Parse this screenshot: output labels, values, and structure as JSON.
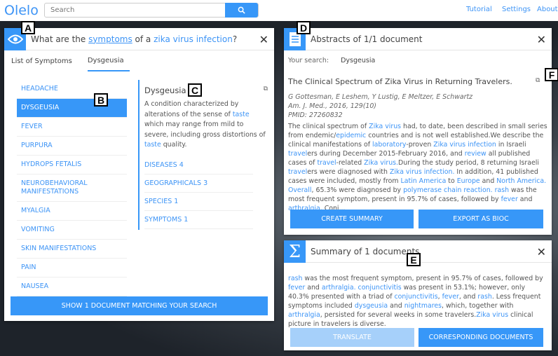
{
  "app": {
    "logo": "Olelo",
    "search_placeholder": "Search",
    "nav": [
      "Tutorial",
      "Settings",
      "About"
    ]
  },
  "colors": {
    "accent": "#3797f8",
    "link": "#3d94f6"
  },
  "question_panel": {
    "title": [
      {
        "t": "What are the "
      },
      {
        "t": "symptoms",
        "link": true,
        "underline": true
      },
      {
        "t": " of a "
      },
      {
        "t": "zika virus infection",
        "link": true
      },
      {
        "t": "?"
      }
    ],
    "icon": "eye-icon",
    "tabs": [
      {
        "label": "List of Symptoms",
        "active": false
      },
      {
        "label": "Dysgeusia",
        "active": true
      }
    ],
    "symptoms": [
      "HEADACHE",
      "DYSGEUSIA",
      "FEVER",
      "PURPURA",
      "HYDROPS FETALIS",
      "NEUROBEHAVIORAL MANIFESTATIONS",
      "MYALGIA",
      "VOMITING",
      "SKIN MANIFESTATIONS",
      "PAIN",
      "NAUSEA"
    ],
    "selected_symptom": "DYSGEUSIA",
    "detail": {
      "title": "Dysgeusia",
      "definition": [
        {
          "t": "A condition characterized by alterations of the sense of "
        },
        {
          "t": "taste",
          "link": true
        },
        {
          "t": " which may range from mild to severe, including gross distortions of "
        },
        {
          "t": "taste",
          "link": true
        },
        {
          "t": " quality."
        }
      ],
      "categories": [
        "DISEASES 4",
        "GEOGRAPHICALS 3",
        "SPECIES 1",
        "SYMPTOMS 1"
      ]
    },
    "show_button": "SHOW 1 DOCUMENT MATCHING YOUR SEARCH"
  },
  "abstracts_panel": {
    "title": "Abstracts of 1/1 document",
    "icon": "document-icon",
    "search_label": "Your search:",
    "search_value": "Dysgeusia",
    "doc_title": "The Clinical Spectrum of Zika Virus in Returning Travelers.",
    "authors": "G Gottesman, E Leshem, Y Lustig, E Meltzer, E Schwartz",
    "journal": "Am. J. Med., 2016, 129(10)",
    "pmid": "PMID: 27260832",
    "abstract": [
      {
        "t": "The clinical spectrum of "
      },
      {
        "t": "Zika virus",
        "link": true
      },
      {
        "t": " had, to date, been described in small series from endemic/"
      },
      {
        "t": "epidemic",
        "link": true
      },
      {
        "t": " countries and is not well established.We describe the clinical manifestations of "
      },
      {
        "t": "laboratory",
        "link": true
      },
      {
        "t": "-proven "
      },
      {
        "t": "Zika virus infection",
        "link": true
      },
      {
        "t": " in Israeli "
      },
      {
        "t": "travel",
        "link": true
      },
      {
        "t": "ers during December 2015-February 2016, and "
      },
      {
        "t": "review",
        "link": true
      },
      {
        "t": " all published cases of "
      },
      {
        "t": "travel",
        "link": true
      },
      {
        "t": "-related "
      },
      {
        "t": "Zika virus.",
        "link": true
      },
      {
        "t": "During the study period, 8 returning Israeli "
      },
      {
        "t": "travel",
        "link": true
      },
      {
        "t": "ers were diagnosed with "
      },
      {
        "t": "Zika virus infection.",
        "link": true
      },
      {
        "t": " In addition, 41 published cases were included, mostly from "
      },
      {
        "t": "Latin America",
        "link": true
      },
      {
        "t": " to "
      },
      {
        "t": "Europe",
        "link": true
      },
      {
        "t": " and "
      },
      {
        "t": "North America. Overall",
        "link": true
      },
      {
        "t": ", 65.3% were diagnosed by "
      },
      {
        "t": "polymerase chain reaction. rash",
        "link": true
      },
      {
        "t": " was the most frequent symptom, present in 95.7% of cases, followed by "
      },
      {
        "t": "fever",
        "link": true
      },
      {
        "t": " and "
      },
      {
        "t": "arthralgia",
        "link": true
      },
      {
        "t": ". Conj..."
      }
    ],
    "buttons": [
      "CREATE SUMMARY",
      "EXPORT AS BIOC"
    ]
  },
  "summary_panel": {
    "title": "Summary of 1 documents",
    "icon": "sigma-icon",
    "text": [
      {
        "t": "rash",
        "link": true
      },
      {
        "t": " was the most frequent symptom, present in 95.7% of cases, followed by "
      },
      {
        "t": "fever",
        "link": true
      },
      {
        "t": " and "
      },
      {
        "t": "arthralgia. conjunctivitis",
        "link": true
      },
      {
        "t": " was present in 53.1%; however, only 40.3% presented with a triad of "
      },
      {
        "t": "conjunctivitis",
        "link": true
      },
      {
        "t": ", "
      },
      {
        "t": "fever",
        "link": true
      },
      {
        "t": ", and "
      },
      {
        "t": "rash",
        "link": true
      },
      {
        "t": ". Less frequent symptoms included "
      },
      {
        "t": "dysgeusia",
        "link": true
      },
      {
        "t": " and "
      },
      {
        "t": "nightmares",
        "link": true
      },
      {
        "t": ", which, together with "
      },
      {
        "t": "arthralgia",
        "link": true
      },
      {
        "t": ", persisted for several weeks in some travelers."
      },
      {
        "t": "Zika virus",
        "link": true
      },
      {
        "t": " clinical picture in travelers is diverse."
      }
    ],
    "buttons": [
      "TRANSLATE",
      "CORRESPONDING DOCUMENTS"
    ]
  },
  "annotations": [
    "A",
    "B",
    "C",
    "D",
    "E",
    "F"
  ]
}
